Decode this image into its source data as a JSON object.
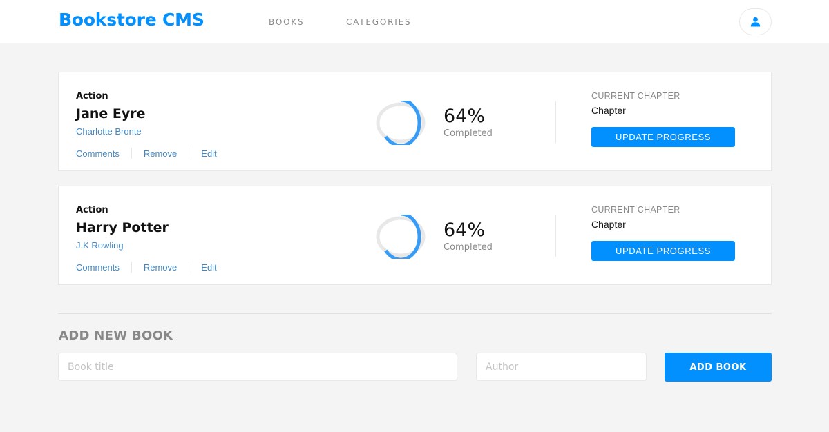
{
  "header": {
    "logo": "Bookstore CMS",
    "nav": [
      {
        "label": "BOOKS"
      },
      {
        "label": "CATEGORIES"
      }
    ],
    "user_icon": "user-icon"
  },
  "books": [
    {
      "category": "Action",
      "title": "Jane Eyre",
      "author": "Charlotte Bronte",
      "actions": [
        "Comments",
        "Remove",
        "Edit"
      ],
      "progress_percent": 64,
      "percent_label": "64%",
      "completed_label": "Completed",
      "chapter_label": "CURRENT CHAPTER",
      "chapter_value": "Chapter",
      "update_label": "UPDATE PROGRESS"
    },
    {
      "category": "Action",
      "title": "Harry Potter",
      "author": "J.K Rowling",
      "actions": [
        "Comments",
        "Remove",
        "Edit"
      ],
      "progress_percent": 64,
      "percent_label": "64%",
      "completed_label": "Completed",
      "chapter_label": "CURRENT CHAPTER",
      "chapter_value": "Chapter",
      "update_label": "UPDATE PROGRESS"
    }
  ],
  "add_form": {
    "title": "ADD NEW BOOK",
    "title_placeholder": "Book title",
    "author_placeholder": "Author",
    "submit_label": "ADD BOOK"
  },
  "colors": {
    "accent": "#0290ff",
    "link": "#4386bf",
    "ring_progress": "#379cf6",
    "ring_track": "#e8e8e8",
    "background": "#f4f4f4"
  }
}
